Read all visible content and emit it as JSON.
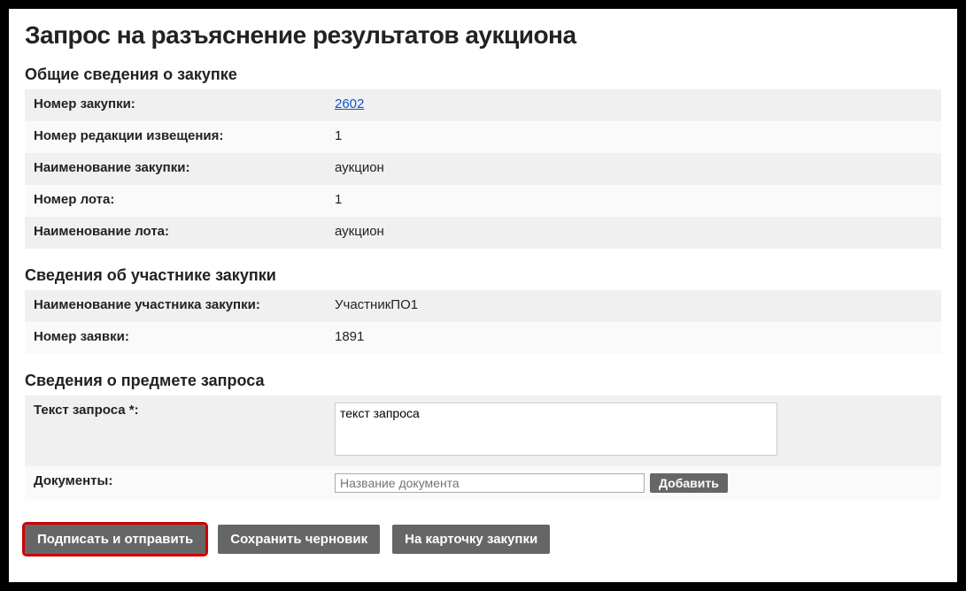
{
  "title": "Запрос на разъяснение результатов аукциона",
  "sections": {
    "general": {
      "heading": "Общие сведения о закупке",
      "purchase_number_label": "Номер закупки:",
      "purchase_number_value": "2602",
      "edition_number_label": "Номер редакции извещения:",
      "edition_number_value": "1",
      "purchase_name_label": "Наименование закупки:",
      "purchase_name_value": "аукцион",
      "lot_number_label": "Номер лота:",
      "lot_number_value": "1",
      "lot_name_label": "Наименование лота:",
      "lot_name_value": "аукцион"
    },
    "participant": {
      "heading": "Сведения об участнике закупки",
      "participant_name_label": "Наименование участника закупки:",
      "participant_name_value": "УчастникПО1",
      "application_number_label": "Номер заявки:",
      "application_number_value": "1891"
    },
    "request": {
      "heading": "Сведения о предмете запроса",
      "request_text_label": "Текст запроса *:",
      "request_text_value": "текст запроса",
      "documents_label": "Документы:",
      "document_name_placeholder": "Название документа",
      "add_button": "Добавить"
    }
  },
  "actions": {
    "sign_and_send": "Подписать и отправить",
    "save_draft": "Сохранить черновик",
    "to_card": "На карточку закупки"
  }
}
